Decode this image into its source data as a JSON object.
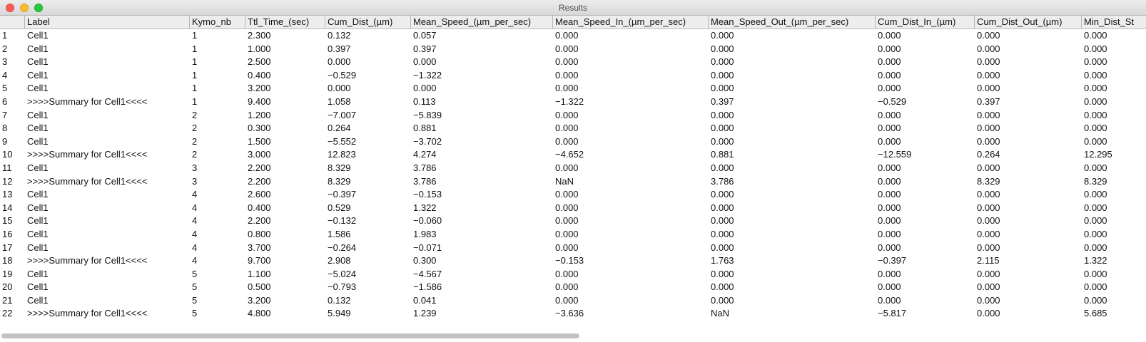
{
  "window": {
    "title": "Results"
  },
  "columns": [
    "",
    "Label",
    "Kymo_nb",
    "Ttl_Time_(sec)",
    "Cum_Dist_(µm)",
    "Mean_Speed_(µm_per_sec)",
    "Mean_Speed_In_(µm_per_sec)",
    "Mean_Speed_Out_(µm_per_sec)",
    "Cum_Dist_In_(µm)",
    "Cum_Dist_Out_(µm)",
    "Min_Dist_St"
  ],
  "rows": [
    [
      "1",
      "Cell1",
      "1",
      "2.300",
      "0.132",
      "0.057",
      "0.000",
      "0.000",
      "0.000",
      "0.000",
      "0.000"
    ],
    [
      "2",
      "Cell1",
      "1",
      "1.000",
      "0.397",
      "0.397",
      "0.000",
      "0.000",
      "0.000",
      "0.000",
      "0.000"
    ],
    [
      "3",
      "Cell1",
      "1",
      "2.500",
      "0.000",
      "0.000",
      "0.000",
      "0.000",
      "0.000",
      "0.000",
      "0.000"
    ],
    [
      "4",
      "Cell1",
      "1",
      "0.400",
      "−0.529",
      "−1.322",
      "0.000",
      "0.000",
      "0.000",
      "0.000",
      "0.000"
    ],
    [
      "5",
      "Cell1",
      "1",
      "3.200",
      "0.000",
      "0.000",
      "0.000",
      "0.000",
      "0.000",
      "0.000",
      "0.000"
    ],
    [
      "6",
      ">>>>Summary for Cell1<<<<",
      "1",
      "9.400",
      "1.058",
      "0.113",
      "−1.322",
      "0.397",
      "−0.529",
      "0.397",
      "0.000"
    ],
    [
      "7",
      "Cell1",
      "2",
      "1.200",
      "−7.007",
      "−5.839",
      "0.000",
      "0.000",
      "0.000",
      "0.000",
      "0.000"
    ],
    [
      "8",
      "Cell1",
      "2",
      "0.300",
      "0.264",
      "0.881",
      "0.000",
      "0.000",
      "0.000",
      "0.000",
      "0.000"
    ],
    [
      "9",
      "Cell1",
      "2",
      "1.500",
      "−5.552",
      "−3.702",
      "0.000",
      "0.000",
      "0.000",
      "0.000",
      "0.000"
    ],
    [
      "10",
      ">>>>Summary for Cell1<<<<",
      "2",
      "3.000",
      "12.823",
      "4.274",
      "−4.652",
      "0.881",
      "−12.559",
      "0.264",
      "12.295"
    ],
    [
      "11",
      "Cell1",
      "3",
      "2.200",
      "8.329",
      "3.786",
      "0.000",
      "0.000",
      "0.000",
      "0.000",
      "0.000"
    ],
    [
      "12",
      ">>>>Summary for Cell1<<<<",
      "3",
      "2.200",
      "8.329",
      "3.786",
      "NaN",
      "3.786",
      "0.000",
      "8.329",
      "8.329"
    ],
    [
      "13",
      "Cell1",
      "4",
      "2.600",
      "−0.397",
      "−0.153",
      "0.000",
      "0.000",
      "0.000",
      "0.000",
      "0.000"
    ],
    [
      "14",
      "Cell1",
      "4",
      "0.400",
      "0.529",
      "1.322",
      "0.000",
      "0.000",
      "0.000",
      "0.000",
      "0.000"
    ],
    [
      "15",
      "Cell1",
      "4",
      "2.200",
      "−0.132",
      "−0.060",
      "0.000",
      "0.000",
      "0.000",
      "0.000",
      "0.000"
    ],
    [
      "16",
      "Cell1",
      "4",
      "0.800",
      "1.586",
      "1.983",
      "0.000",
      "0.000",
      "0.000",
      "0.000",
      "0.000"
    ],
    [
      "17",
      "Cell1",
      "4",
      "3.700",
      "−0.264",
      "−0.071",
      "0.000",
      "0.000",
      "0.000",
      "0.000",
      "0.000"
    ],
    [
      "18",
      ">>>>Summary for Cell1<<<<",
      "4",
      "9.700",
      "2.908",
      "0.300",
      "−0.153",
      "1.763",
      "−0.397",
      "2.115",
      "1.322"
    ],
    [
      "19",
      "Cell1",
      "5",
      "1.100",
      "−5.024",
      "−4.567",
      "0.000",
      "0.000",
      "0.000",
      "0.000",
      "0.000"
    ],
    [
      "20",
      "Cell1",
      "5",
      "0.500",
      "−0.793",
      "−1.586",
      "0.000",
      "0.000",
      "0.000",
      "0.000",
      "0.000"
    ],
    [
      "21",
      "Cell1",
      "5",
      "3.200",
      "0.132",
      "0.041",
      "0.000",
      "0.000",
      "0.000",
      "0.000",
      "0.000"
    ],
    [
      "22",
      ">>>>Summary for Cell1<<<<",
      "5",
      "4.800",
      "5.949",
      "1.239",
      "−3.636",
      "NaN",
      "−5.817",
      "0.000",
      "5.685"
    ]
  ]
}
